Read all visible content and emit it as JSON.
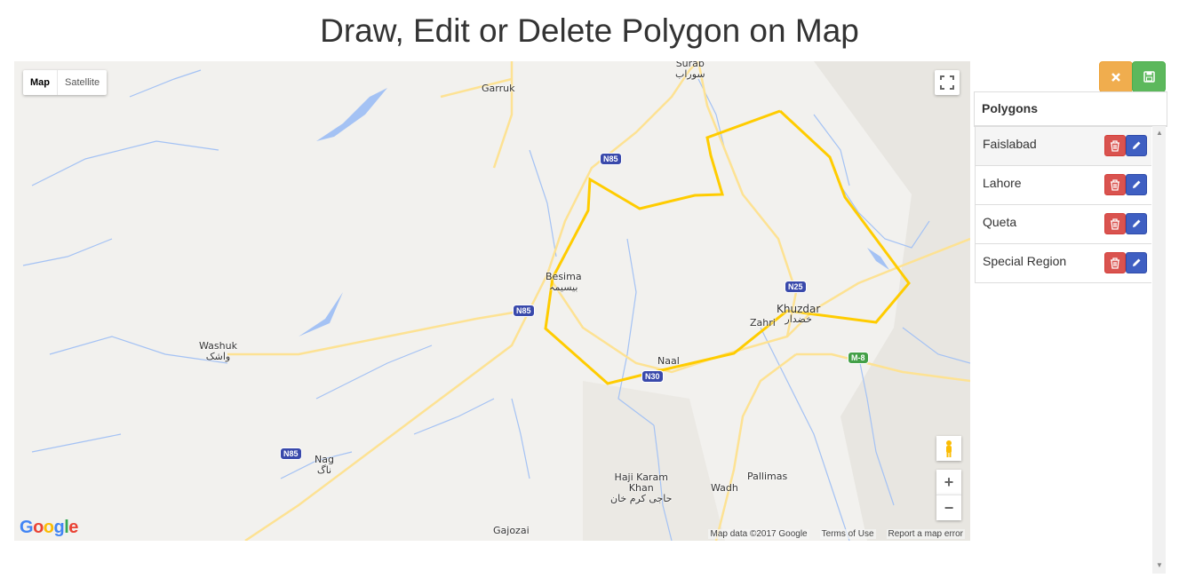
{
  "page": {
    "title": "Draw, Edit or Delete Polygon on Map"
  },
  "map": {
    "map_type_options": [
      "Map",
      "Satellite"
    ],
    "selected_map_type": "Map",
    "attribution": {
      "data": "Map data ©2017 Google",
      "terms": "Terms of Use",
      "report": "Report a map error"
    },
    "zoom_in": "+",
    "zoom_out": "−",
    "places": {
      "surab": "Surab",
      "surab_ur": "سوراب",
      "garruk": "Garruk",
      "besima": "Besima",
      "besima_ur": "بیسیمہ",
      "washuk": "Washuk",
      "washuk_ur": "واشک",
      "khuzdar": "Khuzdar",
      "khuzdar_ur": "خضدار",
      "zahri": "Zahri",
      "naal": "Naal",
      "nag": "Nag",
      "nag_ur": "ناگ",
      "haji_karam_khan_1": "Haji Karam",
      "haji_karam_khan_2": "Khan",
      "haji_karam_khan_ur": "حاجی کرم خان",
      "wadh": "Wadh",
      "pallimas": "Pallimas",
      "gajozai": "Gajozai"
    },
    "road_shields": {
      "n85_1": "N85",
      "n85_2": "N85",
      "n85_3": "N85",
      "n25": "N25",
      "n30": "N30",
      "m8": "M-8"
    },
    "colors": {
      "polygon": "#ffcc00",
      "water": "#a4c2f4",
      "road": "#fde293"
    }
  },
  "toolbar": {
    "cancel_icon": "close-icon",
    "save_icon": "floppy-disk-icon"
  },
  "polygons_panel": {
    "heading": "Polygons",
    "items": [
      {
        "name": "Faislabad"
      },
      {
        "name": "Lahore"
      },
      {
        "name": "Queta"
      },
      {
        "name": "Special Region"
      }
    ]
  }
}
